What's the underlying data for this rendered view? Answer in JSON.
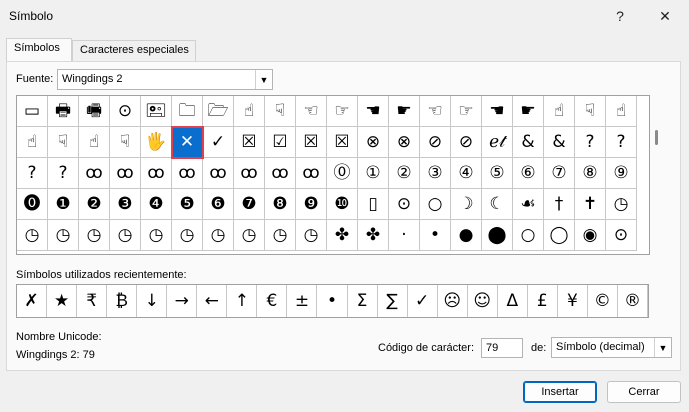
{
  "window": {
    "title": "Símbolo",
    "help": "?",
    "close": "✕"
  },
  "tabs": [
    {
      "label": "Símbolos"
    },
    {
      "label": "Caracteres especiales"
    }
  ],
  "font": {
    "label": "Fuente:",
    "value": "Wingdings 2"
  },
  "grid": {
    "rows": [
      [
        "▭",
        "🖶",
        "🖷",
        "⊙",
        "🖭",
        "🗀",
        "🗁",
        "☝",
        "☟",
        "☜",
        "☞",
        "☚",
        "☛",
        "☜",
        "☞",
        "☚",
        "☛",
        "☝",
        "☟",
        "☝"
      ],
      [
        "☝",
        "☟",
        "☝",
        "☟",
        "🖐",
        "✕",
        "✓",
        "☒",
        "☑",
        "☒",
        "☒",
        "⊗",
        "⊗",
        "⊘",
        "⊘",
        "ℯ𝓉",
        "&",
        "&",
        "?",
        "?"
      ],
      [
        "?",
        "?",
        "ꝏ",
        "ꝏ",
        "ꝏ",
        "ꝏ",
        "ꝏ",
        "ꝏ",
        "ꝏ",
        "ꝏ",
        "⓪",
        "①",
        "②",
        "③",
        "④",
        "⑤",
        "⑥",
        "⑦",
        "⑧",
        "⑨"
      ],
      [
        "⓿",
        "❶",
        "❷",
        "❸",
        "❹",
        "❺",
        "❻",
        "❼",
        "❽",
        "❾",
        "❿",
        "▯",
        "⊙",
        "○",
        "☽",
        "☾",
        "☙",
        "†",
        "✝",
        "◷"
      ],
      [
        "◷",
        "◷",
        "◷",
        "◷",
        "◷",
        "◷",
        "◷",
        "◷",
        "◷",
        "◷",
        "✤",
        "✤",
        "·",
        "•",
        "●",
        "⬤",
        "○",
        "◯",
        "◉",
        "⊙"
      ]
    ]
  },
  "recent": {
    "label": "Símbolos utilizados recientemente:",
    "symbols": [
      "✗",
      "★",
      "₹",
      "₿",
      "↓",
      "→",
      "←",
      "↑",
      "€",
      "±",
      "•",
      "Σ",
      "∑",
      "✓",
      "☹",
      "☺",
      "Δ",
      "£",
      "¥",
      "©",
      "®"
    ]
  },
  "unicode": {
    "label": "Nombre Unicode:",
    "value": "Wingdings 2: 79"
  },
  "charcode": {
    "label": "Código de carácter:",
    "value": "79"
  },
  "from": {
    "label": "de:",
    "value": "Símbolo (decimal)"
  },
  "buttons": {
    "insert": "Insertar",
    "close": "Cerrar"
  },
  "selection": {
    "row": 1,
    "col": 5
  }
}
